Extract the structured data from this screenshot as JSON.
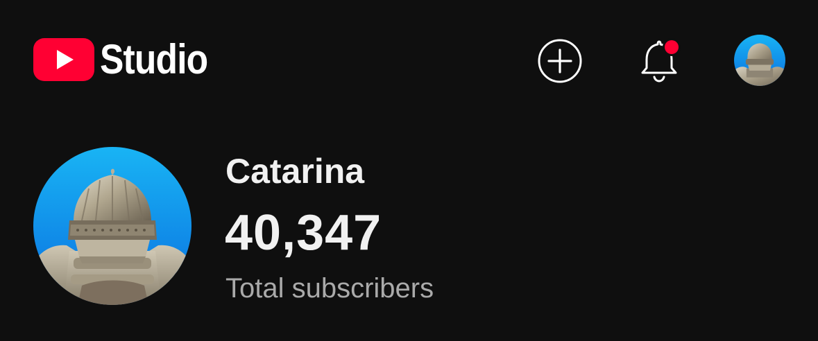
{
  "header": {
    "logo_text": "Studio",
    "logo_icon": "youtube-play-icon",
    "create_icon": "plus-circle-icon",
    "notifications_icon": "bell-icon",
    "notification_dot_color": "#ff0033",
    "account_avatar": "knight-helmet-avatar"
  },
  "channel": {
    "name": "Catarina",
    "subscriber_count": "40,347",
    "subscriber_label": "Total subscribers",
    "avatar": "knight-helmet-avatar"
  },
  "colors": {
    "background": "#0f0f0f",
    "brand_red": "#ff0033",
    "primary_text": "#f1f1f1",
    "secondary_text": "#aaaaaa",
    "avatar_bg_top": "#1ea8ef",
    "avatar_bg_bottom": "#0a6fe0"
  }
}
